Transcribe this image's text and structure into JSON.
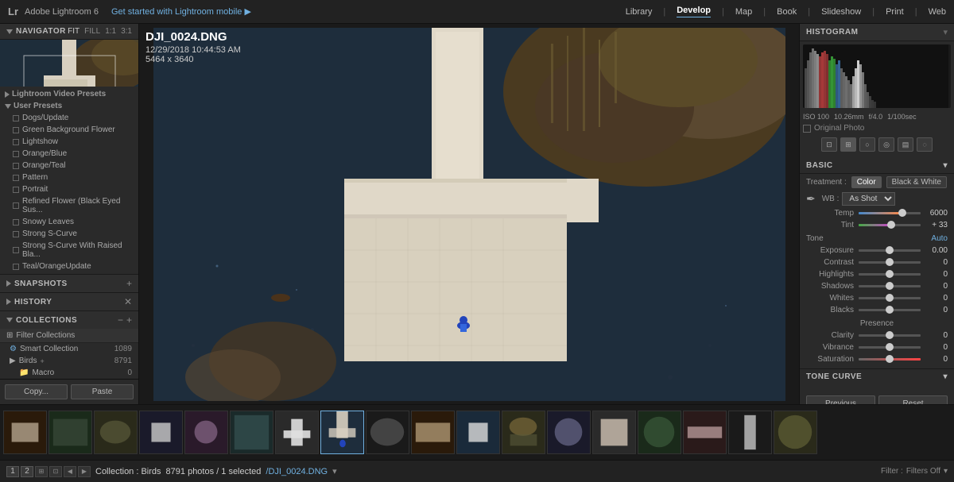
{
  "app": {
    "name": "Adobe Lightroom 6",
    "subtitle": "Get started with Lightroom mobile ▶"
  },
  "nav_menu": {
    "items": [
      "Library",
      "Develop",
      "Map",
      "Book",
      "Slideshow",
      "Print",
      "Web"
    ],
    "active": "Develop"
  },
  "navigator": {
    "label": "Navigator",
    "tabs": [
      "FIT",
      "FILL",
      "1:1",
      "3:1"
    ]
  },
  "photo": {
    "filename": "DJI_0024.DNG",
    "datetime": "12/29/2018 10:44:53 AM",
    "dimensions": "5464 x 3640"
  },
  "presets": {
    "video_label": "Lightroom Video Presets",
    "user_label": "User Presets",
    "items": [
      "Dogs/Update",
      "Green Background Flower",
      "Lightshow",
      "Orange/Blue",
      "Orange/Teal",
      "Pattern",
      "Portrait",
      "Refined Flower (Black Eyed Sus...",
      "Snowy Leaves",
      "Strong S-Curve",
      "Strong S-Curve With Raised Bla...",
      "Teal/OrangeUpdate"
    ]
  },
  "snapshots": {
    "label": "Snapshots"
  },
  "history": {
    "label": "History"
  },
  "collections": {
    "label": "Collections",
    "filter_label": "Filter Collections",
    "items": [
      {
        "name": "Smart Collection",
        "count": "1089",
        "type": "smart"
      },
      {
        "name": "Birds",
        "count": "8791",
        "type": "folder"
      },
      {
        "name": "Macro",
        "count": "0",
        "type": "folder"
      }
    ]
  },
  "panel_buttons": {
    "copy": "Copy...",
    "paste": "Paste"
  },
  "camera_info": {
    "iso": "ISO 100",
    "focal": "10.26mm",
    "aperture": "f/4.0",
    "shutter": "1/100sec"
  },
  "histogram": {
    "label": "Histogram",
    "original_photo": "Original Photo"
  },
  "basic": {
    "label": "Basic",
    "treatment_label": "Treatment :",
    "color_btn": "Color",
    "bw_btn": "Black & White",
    "wb_label": "WB :",
    "wb_value": "As Shot",
    "temp_label": "Temp",
    "temp_value": "6000",
    "tint_label": "Tint",
    "tint_value": "+ 33",
    "tone_label": "Tone",
    "tone_auto": "Auto",
    "exposure_label": "Exposure",
    "exposure_value": "0.00",
    "contrast_label": "Contrast",
    "contrast_value": "0",
    "highlights_label": "Highlights",
    "highlights_value": "0",
    "shadows_label": "Shadows",
    "shadows_value": "0",
    "whites_label": "Whites",
    "whites_value": "0",
    "blacks_label": "Blacks",
    "blacks_value": "0",
    "presence_label": "Presence",
    "clarity_label": "Clarity",
    "clarity_value": "0",
    "vibrance_label": "Vibrance",
    "vibrance_value": "0",
    "saturation_label": "Saturation",
    "saturation_value": "0"
  },
  "tone_curve": {
    "label": "Tone Curve"
  },
  "action_buttons": {
    "previous": "Previous",
    "reset": "Reset"
  },
  "status_bar": {
    "collection_label": "Collection : Birds",
    "photo_count": "8791 photos / 1 selected",
    "filename": "/DJI_0024.DNG",
    "filter_label": "Filter :",
    "filter_value": "Filters Off"
  },
  "colors": {
    "accent": "#70b0e0",
    "active_tab": "#fff",
    "panel_bg": "#2a2a2a",
    "dark_bg": "#1a1a1a"
  }
}
